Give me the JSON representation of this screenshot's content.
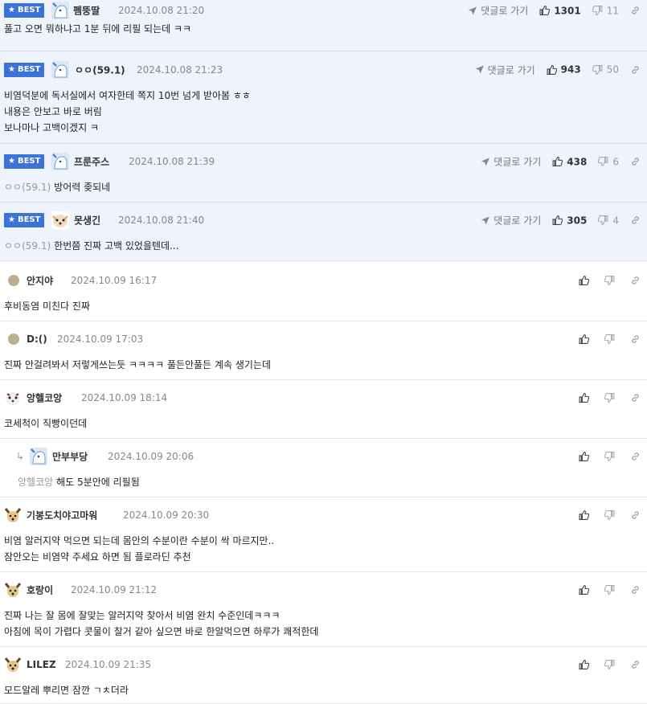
{
  "best_badge_label": "BEST",
  "goto_label": "댓글로 가기",
  "best_comments": [
    {
      "nick": "펨뚱딸",
      "date": "2024.10.08 21:20",
      "up": "1301",
      "down": "11",
      "lines": [
        "풀고 오면 뭐하냐고 1분 뒤에 리필 되는데 ㅋㅋ"
      ],
      "ref": ""
    },
    {
      "nick": "ㅇㅇ(59.1)",
      "date": "2024.10.08 21:23",
      "up": "943",
      "down": "50",
      "lines": [
        "비염덕분에 독서실에서 여자한테 쪽지 10번 넘게 받아봄 ㅎㅎ",
        "내용은 안보고 바로 버림",
        "보나마나 고백이겠지 ㅋ"
      ],
      "ref": ""
    },
    {
      "nick": "프룬주스",
      "date": "2024.10.08 21:39",
      "up": "438",
      "down": "6",
      "lines": [
        "방어력 좆되네"
      ],
      "ref": "ㅇㅇ(59.1)"
    },
    {
      "nick": "못생긴",
      "date": "2024.10.08 21:40",
      "up": "305",
      "down": "4",
      "lines": [
        "한번쯤 진짜 고백 있었을텐데..."
      ],
      "ref": "ㅇㅇ(59.1)"
    }
  ],
  "comments": [
    {
      "nick": "안지야",
      "date": "2024.10.09 16:17",
      "lines": [
        "후비동염 미친다 진짜"
      ],
      "ref": ""
    },
    {
      "nick": "D:()",
      "date": "2024.10.09 17:03",
      "lines": [
        "진짜 안걸려봐서 저렇게쓰는듯 ㅋㅋㅋㅋ 풀든안풀든 계속 생기는데"
      ],
      "ref": ""
    },
    {
      "nick": "앙헬코앙",
      "date": "2024.10.09 18:14",
      "lines": [
        "코세척이 직빵이던데"
      ],
      "ref": ""
    },
    {
      "nick": "만부부당",
      "date": "2024.10.09 20:06",
      "lines": [
        "해도 5분안에 리필됨"
      ],
      "ref": "앙헬코앙"
    },
    {
      "nick": "기봉도치야고마워",
      "date": "2024.10.09 20:30",
      "lines": [
        "비염 알러지약 먹으면 되는데 몸안의 수분이란 수분이 싹 마르지만..",
        "잠안오는 비염약 주세요 하면 됨 플로라딘 추천"
      ],
      "ref": ""
    },
    {
      "nick": "호랑이",
      "date": "2024.10.09 21:12",
      "lines": [
        "진짜 나는 잘 몸에 잘맞는 알러지약 찾아서 비염 완치 수준인데ㅋㅋㅋ",
        "아침에 목이 가렵다 콧물이 찰거 같아 싶으면 바로 한알먹으면 하루가 쾌적한데"
      ],
      "ref": ""
    },
    {
      "nick": "LILEZ",
      "date": "2024.10.09 21:35",
      "lines": [
        "모드알레 뿌리면 잠깐 ㄱㅊ더라"
      ],
      "ref": ""
    }
  ],
  "colors": {
    "best_bg": "#eef3fc",
    "badge": "#3b73d9"
  }
}
